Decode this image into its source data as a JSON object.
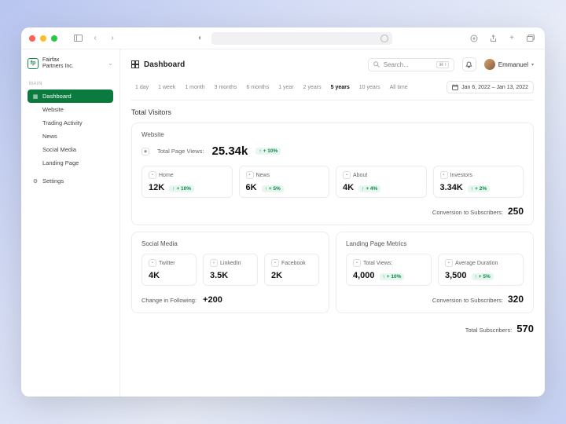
{
  "brand": {
    "logo_text": "fp",
    "line1": "Fairfax",
    "line2": "Partners Inc."
  },
  "sidebar": {
    "section": "MAIN",
    "items": [
      {
        "label": "Dashboard",
        "active": true
      },
      {
        "label": "Website"
      },
      {
        "label": "Trading Activity"
      },
      {
        "label": "News"
      },
      {
        "label": "Social Media"
      },
      {
        "label": "Landing Page"
      }
    ],
    "settings": "Settings"
  },
  "header": {
    "title": "Dashboard",
    "search_placeholder": "Search...",
    "search_shortcut": "⌘ I",
    "user": "Emmanuel"
  },
  "time_ranges": [
    "1 day",
    "1 week",
    "1 month",
    "3 months",
    "6 months",
    "1 year",
    "2 years",
    "5 years",
    "10 years",
    "All time"
  ],
  "time_range_active": "5 years",
  "date_range": "Jan 6, 2022 – Jan 13, 2022",
  "section_title": "Total Visitors",
  "website": {
    "title": "Website",
    "total_label": "Total Page Views:",
    "total_value": "25.34k",
    "total_delta": "+ 10%",
    "stats": [
      {
        "name": "Home",
        "value": "12K",
        "delta": "+ 10%"
      },
      {
        "name": "News",
        "value": "6K",
        "delta": "+ 5%"
      },
      {
        "name": "About",
        "value": "4K",
        "delta": "+ 4%"
      },
      {
        "name": "Investors",
        "value": "3.34K",
        "delta": "+ 2%"
      }
    ],
    "conversion_label": "Conversion to Subscribers:",
    "conversion_value": "250"
  },
  "social": {
    "title": "Social Media",
    "stats": [
      {
        "name": "Twitter",
        "value": "4K"
      },
      {
        "name": "LinkedIn",
        "value": "3.5K"
      },
      {
        "name": "Facebook",
        "value": "2K"
      }
    ],
    "change_label": "Change in Following:",
    "change_value": "+200"
  },
  "landing": {
    "title": "Landing Page Metrics",
    "stats": [
      {
        "name": "Total Views:",
        "value": "4,000",
        "delta": "+ 10%"
      },
      {
        "name": "Average Duration",
        "value": "3,500",
        "delta": "+ 5%"
      }
    ],
    "conversion_label": "Conversion to Subscribers:",
    "conversion_value": "320"
  },
  "total_subs_label": "Total Subscribers:",
  "total_subs_value": "570"
}
